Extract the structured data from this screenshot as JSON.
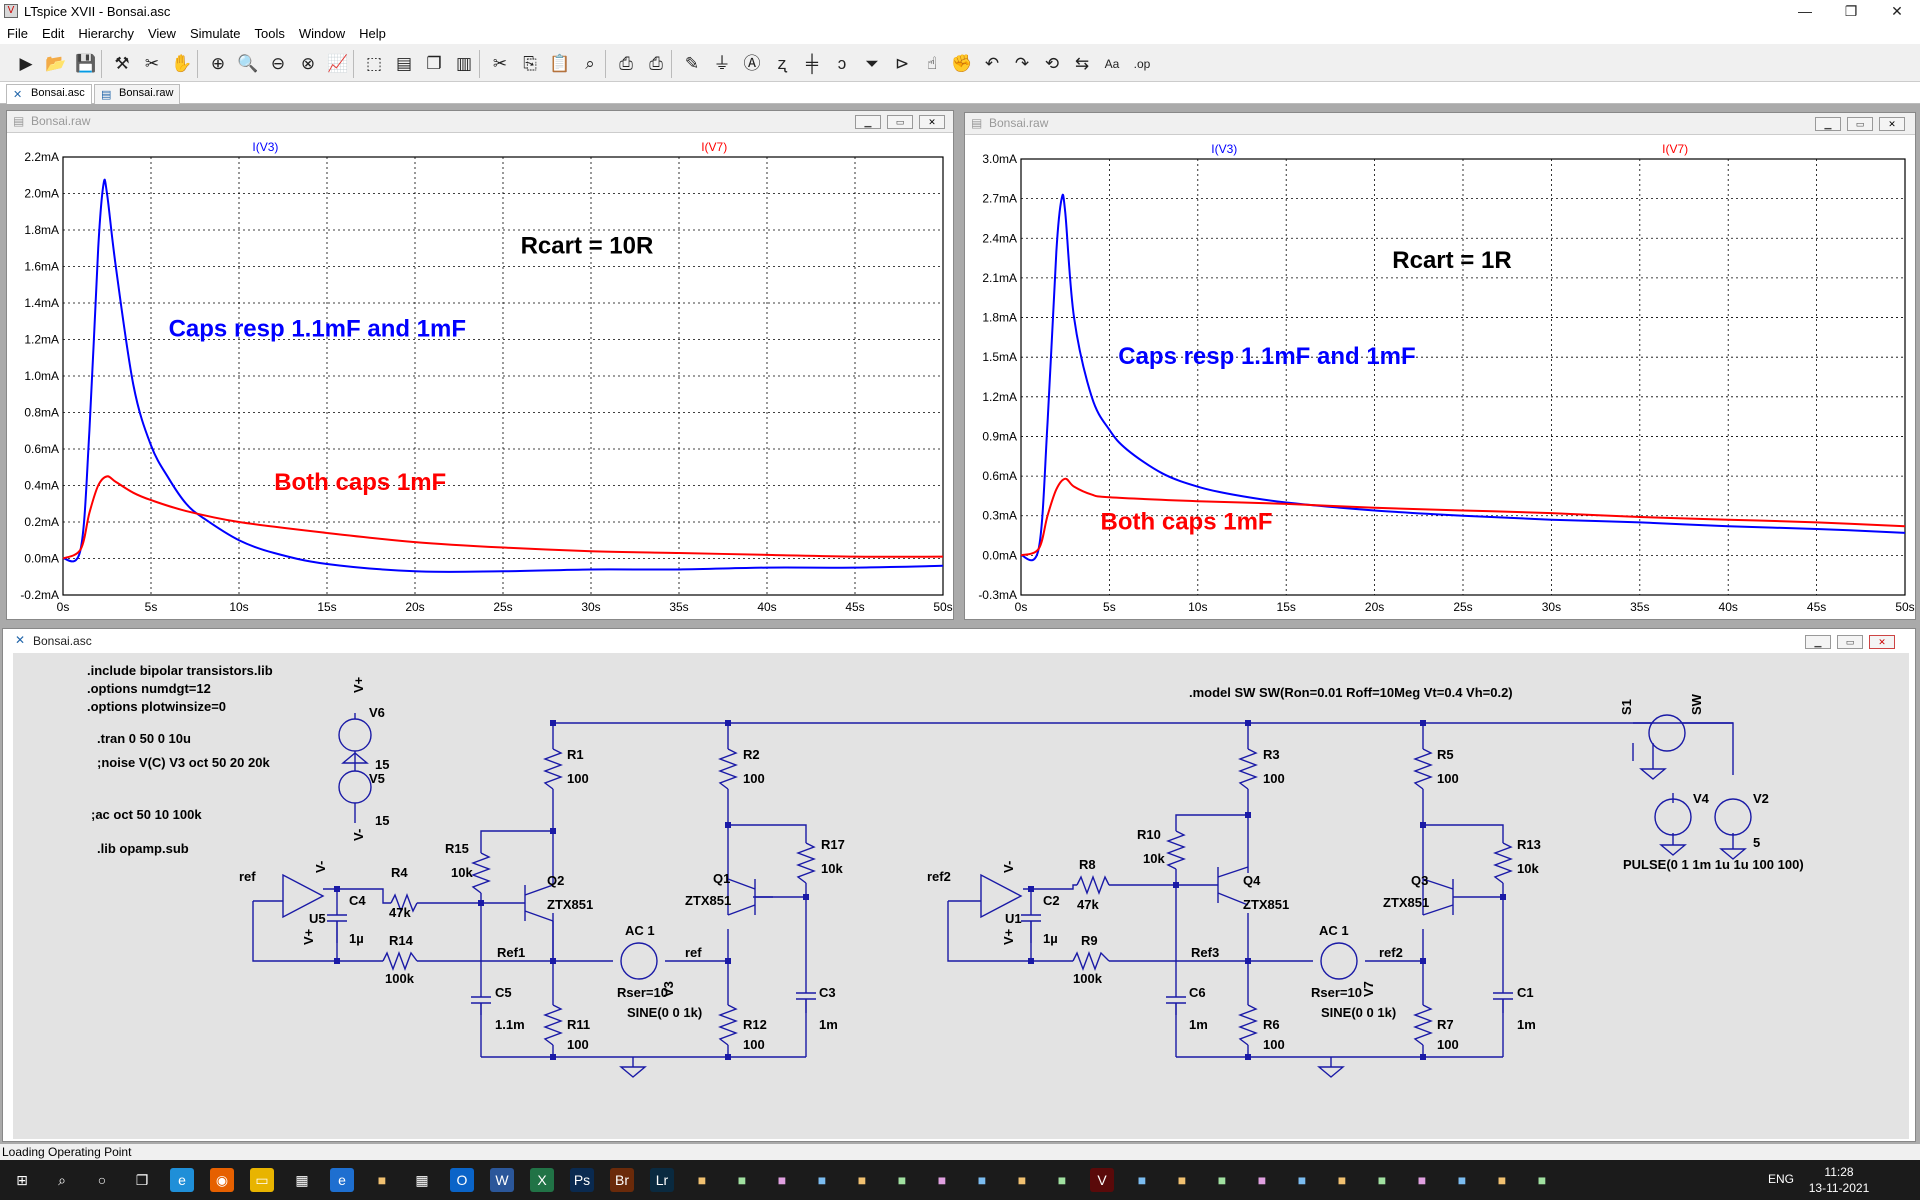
{
  "window": {
    "title": "LTspice XVII - Bonsai.asc",
    "minimize": "—",
    "maximize": "❐",
    "close": "✕"
  },
  "menu": [
    "File",
    "Edit",
    "Hierarchy",
    "View",
    "Simulate",
    "Tools",
    "Window",
    "Help"
  ],
  "toolbar_icons": [
    "run-icon",
    "open-icon",
    "save-icon",
    "hammer-icon",
    "probe-icon",
    "hand-icon",
    "zoom-in-icon",
    "zoom-icon",
    "zoom-out-icon",
    "zoom-cancel-icon",
    "plot-icon",
    "autorange-icon",
    "tile-h-icon",
    "cascade-icon",
    "tile-v-icon",
    "cut-icon",
    "copy-icon",
    "paste-icon",
    "find-icon",
    "print-icon",
    "print-setup-icon",
    "pencil-icon",
    "ground-icon",
    "label-icon",
    "resistor-icon",
    "capacitor-icon",
    "inductor-icon",
    "diode-icon",
    "component-icon",
    "move-icon",
    "drag-icon",
    "undo-icon",
    "redo-icon",
    "rotate-icon",
    "mirror-icon",
    "text-icon",
    "op-icon"
  ],
  "tabs": [
    {
      "label": "Bonsai.asc",
      "icon": "schematic-icon"
    },
    {
      "label": "Bonsai.raw",
      "icon": "waveform-icon"
    }
  ],
  "plots": [
    {
      "title": "Bonsai.raw",
      "chart_data": {
        "type": "line",
        "series": [
          {
            "name": "I(V3)",
            "color": "#0000ff",
            "x": [
              0,
              1,
              1.5,
              2,
              2.3,
              2.5,
              3,
              4,
              5,
              6,
              7,
              8,
              10,
              12,
              15,
              20,
              25,
              30,
              35,
              40,
              45,
              50
            ],
            "y": [
              0,
              0.05,
              0.7,
              1.7,
              2.05,
              2.0,
              1.6,
              0.95,
              0.62,
              0.44,
              0.3,
              0.22,
              0.1,
              0.03,
              -0.03,
              -0.07,
              -0.07,
              -0.06,
              -0.06,
              -0.05,
              -0.05,
              -0.04
            ]
          },
          {
            "name": "I(V7)",
            "color": "#ff0000",
            "x": [
              0,
              1,
              1.5,
              2,
              2.5,
              3,
              4,
              5,
              7,
              10,
              15,
              20,
              25,
              30,
              35,
              40,
              45,
              50
            ],
            "y": [
              0,
              0.05,
              0.25,
              0.4,
              0.45,
              0.42,
              0.36,
              0.32,
              0.26,
              0.2,
              0.14,
              0.09,
              0.06,
              0.04,
              0.03,
              0.02,
              0.01,
              0.01
            ]
          }
        ],
        "xticks": [
          "0s",
          "5s",
          "10s",
          "15s",
          "20s",
          "25s",
          "30s",
          "35s",
          "40s",
          "45s",
          "50s"
        ],
        "yticks": [
          "-0.2mA",
          "0.0mA",
          "0.2mA",
          "0.4mA",
          "0.6mA",
          "0.8mA",
          "1.0mA",
          "1.2mA",
          "1.4mA",
          "1.6mA",
          "1.8mA",
          "2.0mA",
          "2.2mA"
        ],
        "xlim": [
          0,
          50
        ],
        "ylim": [
          -0.2,
          2.2
        ],
        "grid": true,
        "annotations": [
          {
            "text": "Rcart = 10R",
            "color": "#000000"
          },
          {
            "text": "Caps resp 1.1mF and 1mF",
            "color": "#0000ff"
          },
          {
            "text": "Both caps 1mF",
            "color": "#ff0000"
          }
        ]
      }
    },
    {
      "title": "Bonsai.raw",
      "chart_data": {
        "type": "line",
        "series": [
          {
            "name": "I(V3)",
            "color": "#0000ff",
            "x": [
              0,
              1,
              1.5,
              2,
              2.3,
              2.5,
              3,
              4,
              5,
              6,
              8,
              10,
              12,
              15,
              20,
              25,
              30,
              35,
              40,
              45,
              50
            ],
            "y": [
              0,
              0.05,
              1.0,
              2.3,
              2.7,
              2.6,
              1.8,
              1.2,
              0.95,
              0.8,
              0.62,
              0.52,
              0.46,
              0.4,
              0.34,
              0.3,
              0.27,
              0.25,
              0.22,
              0.2,
              0.17
            ]
          },
          {
            "name": "I(V7)",
            "color": "#ff0000",
            "x": [
              0,
              1,
              1.5,
              2,
              2.5,
              3,
              4,
              5,
              10,
              15,
              20,
              25,
              30,
              35,
              40,
              45,
              50
            ],
            "y": [
              0,
              0.05,
              0.3,
              0.5,
              0.58,
              0.52,
              0.46,
              0.44,
              0.41,
              0.39,
              0.36,
              0.34,
              0.32,
              0.29,
              0.27,
              0.25,
              0.22
            ]
          }
        ],
        "xticks": [
          "0s",
          "5s",
          "10s",
          "15s",
          "20s",
          "25s",
          "30s",
          "35s",
          "40s",
          "45s",
          "50s"
        ],
        "yticks": [
          "-0.3mA",
          "0.0mA",
          "0.3mA",
          "0.6mA",
          "0.9mA",
          "1.2mA",
          "1.5mA",
          "1.8mA",
          "2.1mA",
          "2.4mA",
          "2.7mA",
          "3.0mA"
        ],
        "xlim": [
          0,
          50
        ],
        "ylim": [
          -0.3,
          3.0
        ],
        "grid": true,
        "annotations": [
          {
            "text": "Rcart = 1R",
            "color": "#000000"
          },
          {
            "text": "Caps resp 1.1mF and 1mF",
            "color": "#0000ff"
          },
          {
            "text": "Both caps 1mF",
            "color": "#ff0000"
          }
        ]
      }
    }
  ],
  "schematic": {
    "title": "Bonsai.asc",
    "directives": {
      "include": ".include bipolar transistors.lib",
      "numdgt": ".options numdgt=12",
      "plotwinsize": ".options plotwinsize=0",
      "tran": ".tran 0 50 0 10u",
      "noise": ";noise V(C) V3 oct 50 20 20k",
      "ac": ";ac oct 50 10 100k",
      "lib": ".lib opamp.sub",
      "model": ".model SW SW(Ron=0.01 Roff=10Meg Vt=0.4 Vh=0.2)",
      "pulse": "PULSE(0 1 1m 1u 1u 100 100)"
    },
    "labels": {
      "R1": "R1",
      "R1v": "100",
      "R2": "R2",
      "R2v": "100",
      "R3": "R3",
      "R3v": "100",
      "R5": "R5",
      "R5v": "100",
      "R15": "R15",
      "R15v": "10k",
      "R17": "R17",
      "R17v": "10k",
      "R10": "R10",
      "R10v": "10k",
      "R13": "R13",
      "R13v": "10k",
      "R4": "R4",
      "R4v": "47k",
      "R8": "R8",
      "R8v": "47k",
      "R14": "R14",
      "R14v": "100k",
      "R9": "R9",
      "R9v": "100k",
      "R11": "R11",
      "R11v": "100",
      "R12": "R12",
      "R12v": "100",
      "R6": "R6",
      "R6v": "100",
      "R7": "R7",
      "R7v": "100",
      "C4": "C4",
      "C4v": "1µ",
      "C2": "C2",
      "C2v": "1µ",
      "C5": "C5",
      "C5v": "1.1m",
      "C3": "C3",
      "C3v": "1m",
      "C6": "C6",
      "C6v": "1m",
      "C1": "C1",
      "C1v": "1m",
      "Q2": "Q2",
      "Q2m": "ZTX851",
      "Q1": "Q1",
      "Q1m": "ZTX851",
      "Q4": "Q4",
      "Q4m": "ZTX851",
      "Q3": "Q3",
      "Q3m": "ZTX851",
      "U5": "U5",
      "U1": "U1",
      "V6": "V6",
      "V6v": "15",
      "V5": "V5",
      "V5v": "15",
      "Vp": "V+",
      "Vm": "V-",
      "V3": "V3",
      "V7": "V7",
      "V3ac": "AC 1",
      "V7ac": "AC 1",
      "V3rser": "Rser=10",
      "V7rser": "Rser=10",
      "V3sine": "SINE(0 0 1k)",
      "V7sine": "SINE(0 0 1k)",
      "V4": "V4",
      "V2": "V2",
      "V2v": "5",
      "S1": "S1",
      "SW": "SW",
      "ref": "ref",
      "ref_net": "ref",
      "ref2": "ref2",
      "ref2_net": "ref2",
      "Ref1": "Ref1",
      "Ref3": "Ref3",
      "U5vm": "V-",
      "U5vp": "V+",
      "U1vm": "V-",
      "U1vp": "V+",
      "plus": "+",
      "minus": "-"
    }
  },
  "status": "Loading Operating Point",
  "taskbar": {
    "icons": [
      "windows-start-icon",
      "search-icon",
      "cortana-icon",
      "task-view-icon",
      "edge-icon",
      "firefox-icon",
      "file-explorer-icon",
      "store-icon",
      "ie-icon",
      "app-icon",
      "calculator-icon",
      "outlook-icon",
      "word-icon",
      "excel-icon",
      "photoshop-icon",
      "bridge-icon",
      "lightroom-icon",
      "app-icon",
      "app-icon",
      "app-icon",
      "app-icon",
      "app-icon",
      "app-icon",
      "app-icon",
      "app-icon",
      "app-icon",
      "app-icon",
      "ltspice-icon",
      "app-icon",
      "app-icon",
      "app-icon",
      "app-icon",
      "app-icon",
      "app-icon",
      "app-icon",
      "app-icon",
      "app-icon",
      "app-icon",
      "app-icon"
    ],
    "lang": "ENG",
    "time": "11:28",
    "date": "13-11-2021"
  }
}
